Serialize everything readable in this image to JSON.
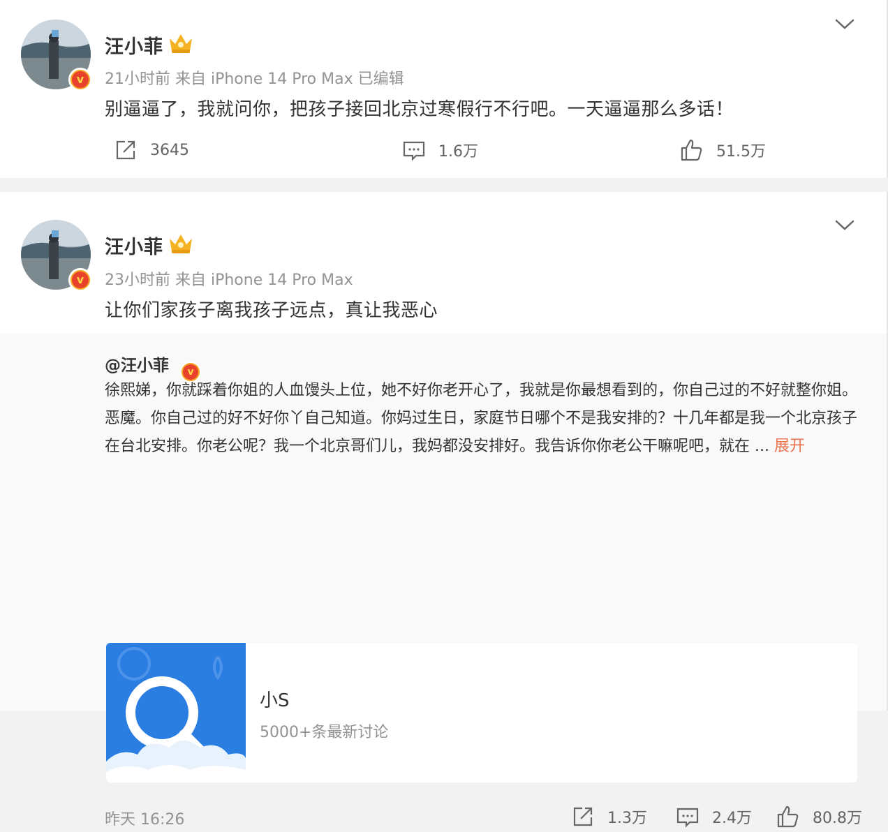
{
  "posts": [
    {
      "author": "汪小菲",
      "meta": "21小时前 来自 iPhone 14 Pro Max 已编辑",
      "text": "别逼逼了，我就问你，把孩子接回北京过寒假行不行吧。一天逼逼那么多话！",
      "shares": "3645",
      "comments": "1.6万",
      "likes": "51.5万"
    },
    {
      "author": "汪小菲",
      "meta": "23小时前 来自 iPhone 14 Pro Max",
      "text": "让你们家孩子离我孩子远点，真让我恶心",
      "repost": {
        "user": "@汪小菲",
        "text": "徐熙娣，你就踩着你姐的人血馒头上位，她不好你老开心了，我就是你最想看到的，你自己过的不好就整你姐。恶魔。你自己过的好不好你丫自己知道。你妈过生日，家庭节日哪个不是我安排的？十几年都是我一个北京孩子在台北安排。你老公呢？我一个北京哥们儿，我妈都没安排好。我告诉你你老公干嘛呢吧，就在 ...",
        "expand": "展开",
        "topic_title": "小S",
        "topic_sub": "5000+条最新讨论",
        "time": "昨天 16:26",
        "shares": "1.3万",
        "comments": "2.4万",
        "likes": "80.8万"
      }
    }
  ],
  "colors": {
    "accent": "#eb7350",
    "vip_badge": "#f5a623",
    "topic_blue": "#2a7de1"
  },
  "icons": [
    "chevron-down-icon",
    "share-icon",
    "comment-icon",
    "like-icon",
    "crown-icon",
    "verified-icon",
    "search-icon"
  ]
}
